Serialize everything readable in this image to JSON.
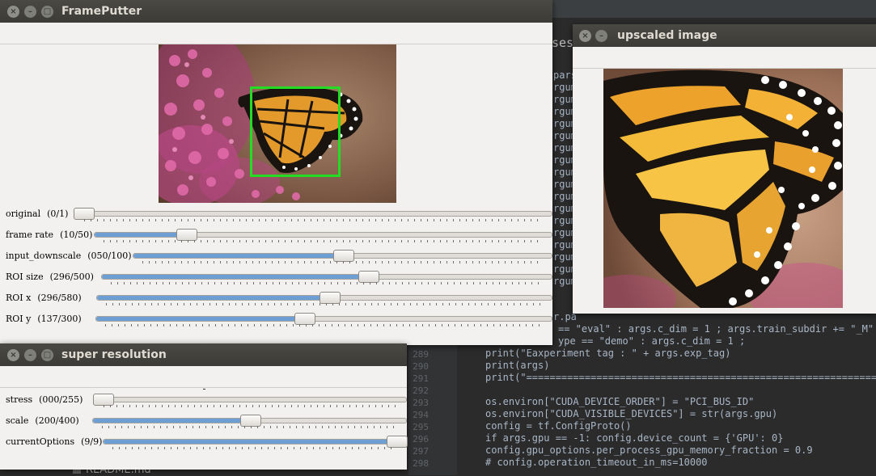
{
  "ide": {
    "partial_tab": "sess",
    "readme_tab": "README.md",
    "line_numbers": [
      "289",
      "290",
      "291",
      "292",
      "293",
      "294",
      "295",
      "296",
      "297",
      "298"
    ],
    "partial_lines": [
      "== \"eval\" : args.c_dim = 1 ; args.train_subdir += \"_M\" ;",
      "ype == \"demo\" : args.c_dim = 1 ;"
    ],
    "code_lines": [
      "print(\"Eaxperiment tag : \" + args.exp_tag)",
      "print(args)",
      "print(\"=================================================================",
      "",
      "os.environ[\"CUDA_DEVICE_ORDER\"] = \"PCI_BUS_ID\"",
      "os.environ[\"CUDA_VISIBLE_DEVICES\"] = str(args.gpu)",
      "config = tf.ConfigProto()",
      "if args.gpu == -1: config.device_count = {'GPU': 0}",
      "config.gpu_options.per_process_gpu_memory_fraction = 0.9",
      "# config.operation_timeout_in_ms=10000"
    ],
    "left_fragments": [
      "pars",
      "rgum",
      "rgum",
      "rgum",
      "rgum",
      "rgum",
      "rgum",
      "rgum",
      "rgum",
      "rgum",
      "rgum",
      "rgum",
      "rgum",
      "rgum",
      "rgum",
      "rgum",
      "rgum",
      "rgum"
    ],
    "rpa_fragment": "r.pa"
  },
  "framePutter": {
    "title": "FramePutter",
    "trackbars": [
      {
        "label": "original",
        "value": "(0/1)",
        "fraction": 0.0
      },
      {
        "label": "frame rate",
        "value": "(10/50)",
        "fraction": 0.2
      },
      {
        "label": "input_downscale",
        "value": "(050/100)",
        "fraction": 0.5
      },
      {
        "label": "ROI size",
        "value": "(296/500)",
        "fraction": 0.592
      },
      {
        "label": "ROI x",
        "value": "(296/580)",
        "fraction": 0.51
      },
      {
        "label": "ROI y",
        "value": "(137/300)",
        "fraction": 0.457
      }
    ],
    "roi_color": "#22dd22"
  },
  "upscaled": {
    "title": "upscaled image"
  },
  "superResolution": {
    "title": "super resolution",
    "trackbars": [
      {
        "label": "stress",
        "value": "(000/255)",
        "fraction": 0.0
      },
      {
        "label": "scale",
        "value": "(200/400)",
        "fraction": 0.5
      },
      {
        "label": "currentOptions",
        "value": "(9/9)",
        "fraction": 1.0
      }
    ]
  },
  "window_buttons": {
    "close": "×",
    "minimize": "–",
    "maximize": "□"
  }
}
